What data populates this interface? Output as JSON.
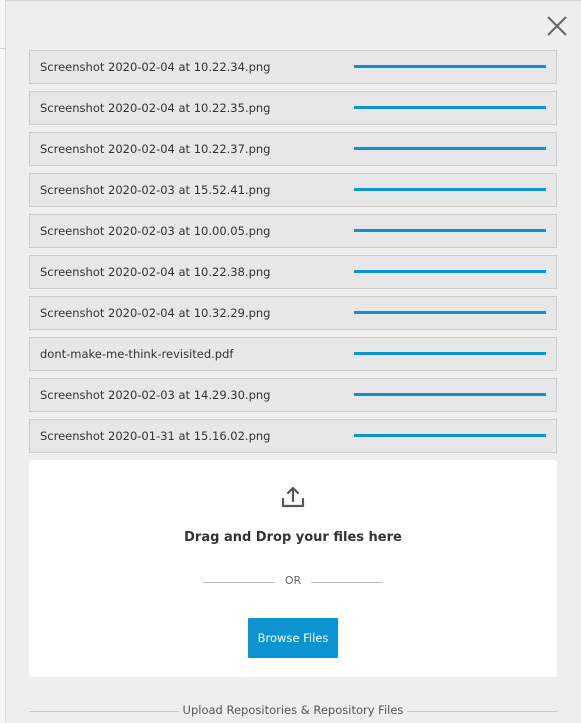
{
  "files": [
    {
      "name": "Screenshot 2020-02-04 at 10.22.34.png",
      "progress": 1.0
    },
    {
      "name": "Screenshot 2020-02-04 at 10.22.35.png",
      "progress": 1.0
    },
    {
      "name": "Screenshot 2020-02-04 at 10.22.37.png",
      "progress": 1.0
    },
    {
      "name": "Screenshot 2020-02-03 at 15.52.41.png",
      "progress": 1.0
    },
    {
      "name": "Screenshot 2020-02-03 at 10.00.05.png",
      "progress": 1.0
    },
    {
      "name": "Screenshot 2020-02-04 at 10.22.38.png",
      "progress": 1.0
    },
    {
      "name": "Screenshot 2020-02-04 at 10.32.29.png",
      "progress": 1.0
    },
    {
      "name": "dont-make-me-think-revisited.pdf",
      "progress": 1.0
    },
    {
      "name": "Screenshot 2020-02-03 at 14.29.30.png",
      "progress": 1.0
    },
    {
      "name": "Screenshot 2020-01-31 at 15.16.02.png",
      "progress": 1.0
    }
  ],
  "dropzone": {
    "icon": "upload-icon",
    "instruction": "Drag and Drop your files here",
    "or_label": "OR",
    "browse_label": "Browse Files"
  },
  "footer": {
    "label": "Upload Repositories & Repository Files"
  },
  "colors": {
    "accent": "#0c93d2",
    "background": "#eeeeee",
    "row_background": "#e7e7e7"
  }
}
